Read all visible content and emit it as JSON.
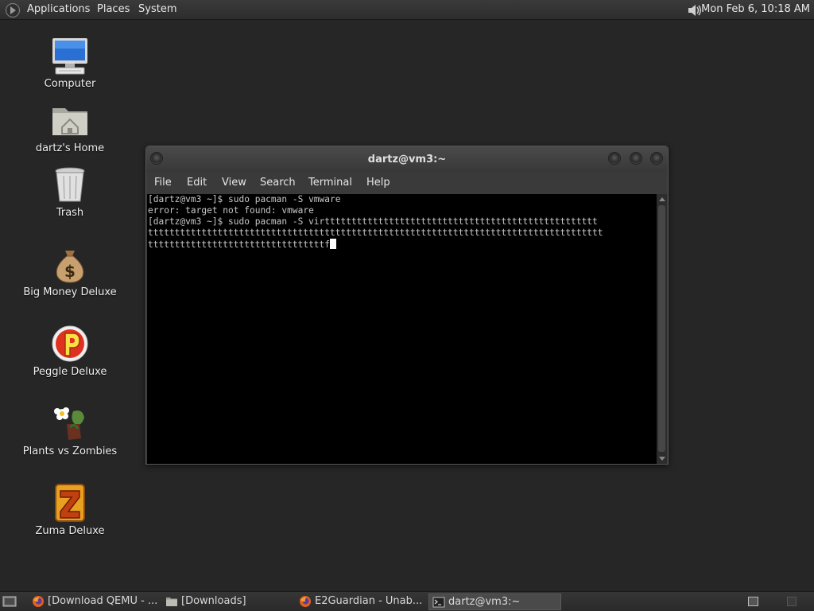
{
  "top_panel": {
    "menus": [
      "Applications",
      "Places",
      "System"
    ],
    "clock": "Mon Feb  6, 10:18 AM"
  },
  "desktop_icons": [
    {
      "label": "Computer",
      "icon": "computer-icon"
    },
    {
      "label": "dartz's Home",
      "icon": "home-folder-icon"
    },
    {
      "label": "Trash",
      "icon": "trash-icon"
    },
    {
      "label": "Big Money Deluxe",
      "icon": "money-bag-icon"
    },
    {
      "label": "Peggle Deluxe",
      "icon": "peggle-icon"
    },
    {
      "label": "Plants vs Zombies",
      "icon": "plants-vs-zombies-icon"
    },
    {
      "label": "Zuma Deluxe",
      "icon": "zuma-icon"
    }
  ],
  "terminal": {
    "title": "dartz@vm3:~",
    "menu": [
      "File",
      "Edit",
      "View",
      "Search",
      "Terminal",
      "Help"
    ],
    "lines": [
      "[dartz@vm3 ~]$ sudo pacman -S vmware",
      "error: target not found: vmware",
      "[dartz@vm3 ~]$ sudo pacman -S virttttttttttttttttttttttttttttttttttttttttttttttttttt",
      "ttttttttttttttttttttttttttttttttttttttttttttttttttttttttttttttttttttttttttttttttttttt",
      "tttttttttttttttttttttttttttttttttf"
    ]
  },
  "taskbar": {
    "tasks": [
      {
        "label": "[Download QEMU - ...",
        "icon": "firefox-icon",
        "active": false
      },
      {
        "label": "[Downloads]",
        "icon": "folder-icon",
        "active": false
      },
      {
        "label": "E2Guardian - Unab...",
        "icon": "firefox-icon",
        "active": false
      },
      {
        "label": "dartz@vm3:~",
        "icon": "terminal-icon",
        "active": true
      }
    ]
  },
  "colors": {
    "desktop_bg": "#262626",
    "panel_bg": "#2d2d2d",
    "terminal_bg": "#000000",
    "terminal_fg": "#c8c8c8"
  }
}
